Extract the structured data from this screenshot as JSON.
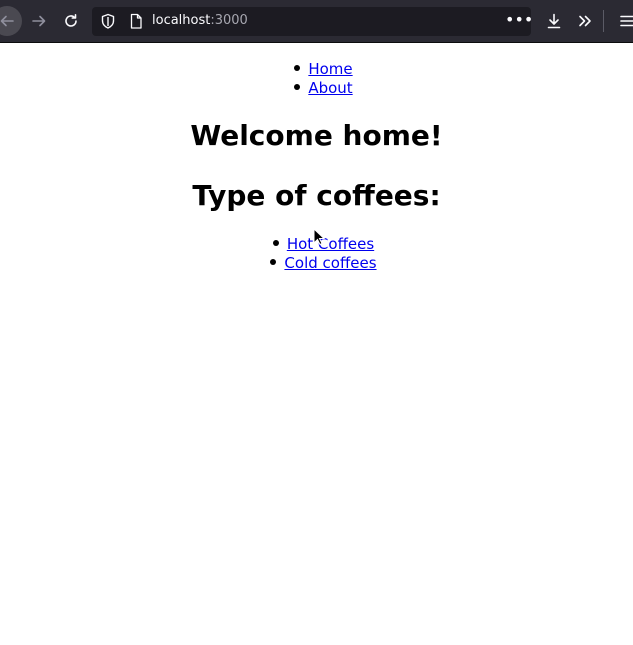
{
  "browser": {
    "url_host": "localhost",
    "url_port": ":3000",
    "more_label": "•••"
  },
  "icons": {
    "back": "back-arrow-icon",
    "forward": "forward-arrow-icon",
    "reload": "reload-icon",
    "shield": "shield-icon",
    "page": "page-icon",
    "download": "download-icon",
    "overflow": "chevron-double-right-icon",
    "menu": "hamburger-menu-icon",
    "cursor": "mouse-pointer-icon"
  },
  "nav": {
    "items": [
      {
        "label": "Home"
      },
      {
        "label": "About"
      }
    ]
  },
  "main": {
    "heading": "Welcome home!",
    "subheading": "Type of coffees:",
    "coffees": [
      {
        "label": "Hot Coffees"
      },
      {
        "label": "Cold coffees"
      }
    ]
  },
  "colors": {
    "toolbar_bg": "#2b2a33",
    "urlbar_bg": "#1c1b22",
    "link": "#0000ee",
    "page_bg": "#ffffff"
  }
}
